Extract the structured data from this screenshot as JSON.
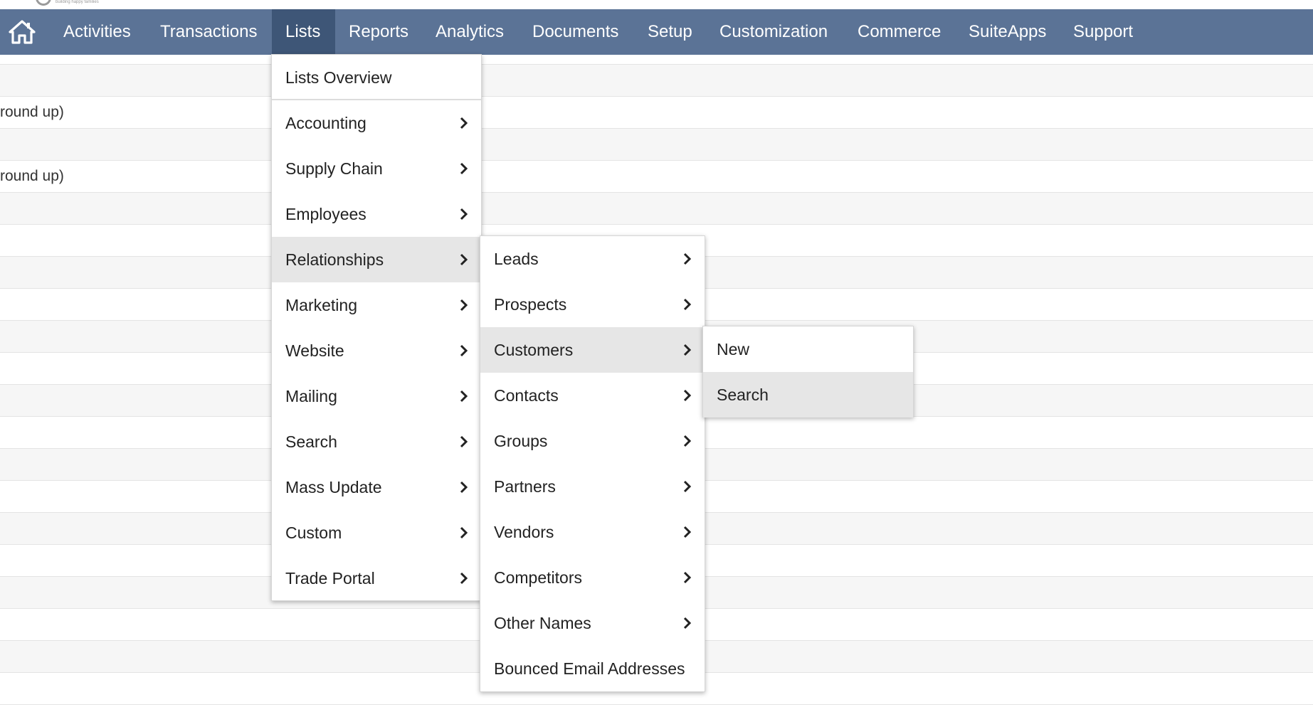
{
  "logo": {
    "tagline": "building happy families"
  },
  "nav": {
    "home_icon": "home-icon",
    "items": [
      {
        "label": "Activities"
      },
      {
        "label": "Transactions"
      },
      {
        "label": "Lists"
      },
      {
        "label": "Reports"
      },
      {
        "label": "Analytics"
      },
      {
        "label": "Documents"
      },
      {
        "label": "Setup"
      },
      {
        "label": "Customization"
      },
      {
        "label": "Commerce"
      },
      {
        "label": "SuiteApps"
      },
      {
        "label": "Support"
      }
    ],
    "active": "Lists",
    "bar_color": "#5b7396",
    "active_color": "#3e5677"
  },
  "background": {
    "row_texts": [
      "round up)",
      "round up)"
    ]
  },
  "lists_menu": {
    "items": [
      {
        "label": "Lists Overview"
      },
      {
        "label": "Accounting"
      },
      {
        "label": "Supply Chain"
      },
      {
        "label": "Employees"
      },
      {
        "label": "Relationships"
      },
      {
        "label": "Marketing"
      },
      {
        "label": "Website"
      },
      {
        "label": "Mailing"
      },
      {
        "label": "Search"
      },
      {
        "label": "Mass Update"
      },
      {
        "label": "Custom"
      },
      {
        "label": "Trade Portal"
      }
    ],
    "highlighted": "Relationships"
  },
  "relationships_menu": {
    "items": [
      {
        "label": "Leads"
      },
      {
        "label": "Prospects"
      },
      {
        "label": "Customers"
      },
      {
        "label": "Contacts"
      },
      {
        "label": "Groups"
      },
      {
        "label": "Partners"
      },
      {
        "label": "Vendors"
      },
      {
        "label": "Competitors"
      },
      {
        "label": "Other Names"
      },
      {
        "label": "Bounced Email Addresses"
      }
    ],
    "highlighted": "Customers"
  },
  "customers_menu": {
    "items": [
      {
        "label": "New"
      },
      {
        "label": "Search"
      }
    ],
    "highlighted": "Search"
  }
}
